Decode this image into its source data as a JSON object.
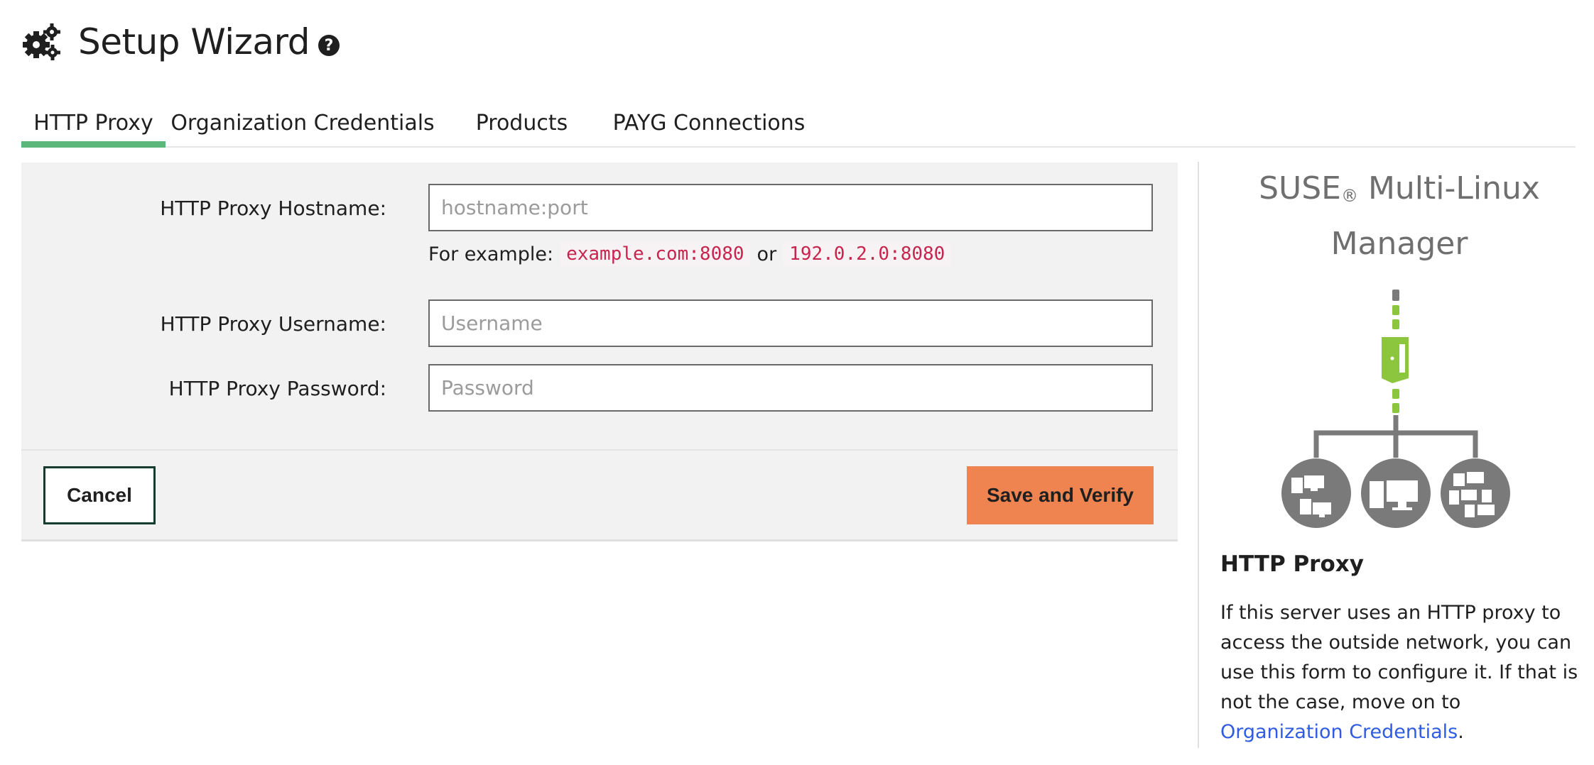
{
  "header": {
    "title": "Setup Wizard",
    "title_icon": "gears-icon",
    "help_icon": "help-icon",
    "help_glyph": "?"
  },
  "tabs": [
    {
      "label": "HTTP Proxy",
      "active": true
    },
    {
      "label": "Organization Credentials",
      "active": false
    },
    {
      "label": "Products",
      "active": false
    },
    {
      "label": "PAYG Connections",
      "active": false
    }
  ],
  "form": {
    "hostname_label": "HTTP Proxy Hostname:",
    "hostname_placeholder": "hostname:port",
    "hostname_value": "",
    "example_prefix": "For example:",
    "example_1": "example.com:8080",
    "example_or": "or",
    "example_2": "192.0.2.0:8080",
    "username_label": "HTTP Proxy Username:",
    "username_placeholder": "Username",
    "username_value": "",
    "password_label": "HTTP Proxy Password:",
    "password_placeholder": "Password",
    "password_value": "",
    "cancel_label": "Cancel",
    "save_label": "Save and Verify"
  },
  "sidebar": {
    "product_name": "SUSE",
    "product_reg": "®",
    "product_rest": " Multi-Linux Manager",
    "heading": "HTTP Proxy",
    "text": "If this server uses an HTTP proxy to access the outside network, you can use this form to configure it. If that is not the case, move on to ",
    "link_label": "Organization Credentials",
    "text_end": "."
  },
  "colors": {
    "accent_green": "#5cb87a",
    "save_orange": "#ef8451",
    "cancel_border": "#163c2f",
    "link_blue": "#2f5ce0",
    "code_red": "#c7254e",
    "diagram_grey": "#7a7a7a",
    "diagram_green": "#8cc63f"
  }
}
